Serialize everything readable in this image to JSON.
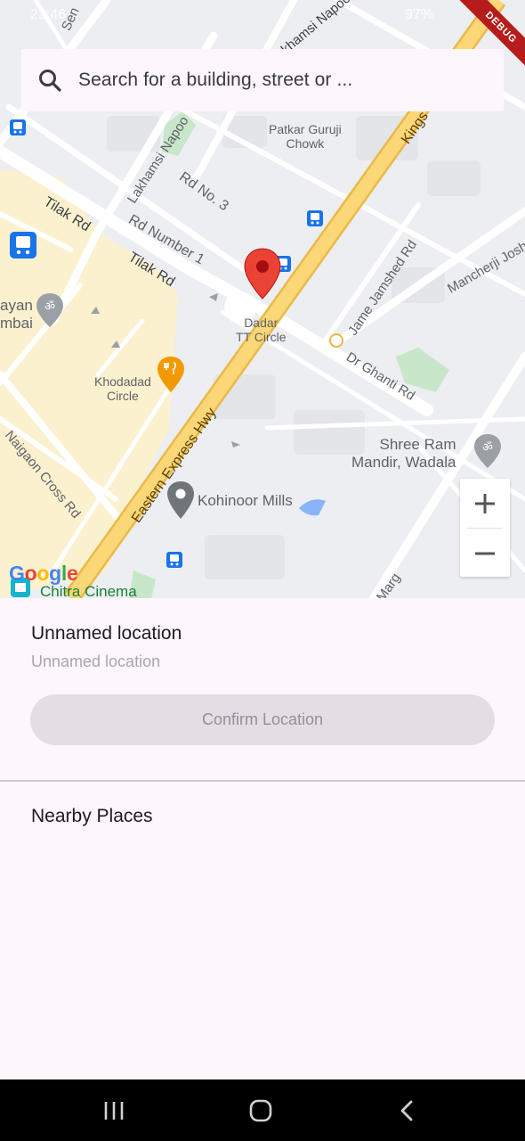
{
  "status_bar": {
    "time": "22:46",
    "right": "97%"
  },
  "debug_banner": "DEBUG",
  "search": {
    "placeholder": "Search for a building, street or ...",
    "icon": "search-icon"
  },
  "map": {
    "streets": [
      {
        "text": "Tilak Rd"
      },
      {
        "text": "Tilak Rd"
      },
      {
        "text": "Rd Number 1"
      },
      {
        "text": "Rd No. 3"
      },
      {
        "text": "Lakhamsi Napoo"
      },
      {
        "text": "Lakhamsi Napoo R"
      },
      {
        "text": "Eastern Express Hwy"
      },
      {
        "text": "Kings"
      },
      {
        "text": "Jame Jamshed Rd"
      },
      {
        "text": "Mancherji Josh"
      },
      {
        "text": "Dr Ghanti Rd"
      },
      {
        "text": "Naigaon Cross Rd"
      },
      {
        "text": "Marg"
      },
      {
        "text": "Sen"
      }
    ],
    "places": [
      {
        "text": "Patkar Guruji\nChowk"
      },
      {
        "text": "Dadar\nTT Circle"
      },
      {
        "text": "Khodadad\nCircle"
      },
      {
        "text": "Shree Ram\nMandir, Wadala"
      },
      {
        "text": "Kohinoor Mills"
      },
      {
        "text": "Chitra Cinema"
      },
      {
        "text": "ayan\nmbai"
      }
    ],
    "google_logo": "Google",
    "zoom_in": "+",
    "zoom_out": "−",
    "colors": {
      "road_major": "#fbd777",
      "road_major_edge": "#e9b949",
      "road": "#ffffff",
      "land": "#eceef1",
      "urban": "#fbf1cf",
      "park": "#c8e6c9",
      "pin": "#ea4335",
      "transit": "#1a73e8",
      "poi_grey": "#5f6368",
      "food": "#f29900"
    }
  },
  "sheet": {
    "title": "Unnamed location",
    "subtitle": "Unnamed location",
    "confirm_label": "Confirm Location",
    "nearby_title": "Nearby Places"
  },
  "navbar": {
    "recents": "recents-icon",
    "home": "home-icon",
    "back": "back-icon"
  }
}
